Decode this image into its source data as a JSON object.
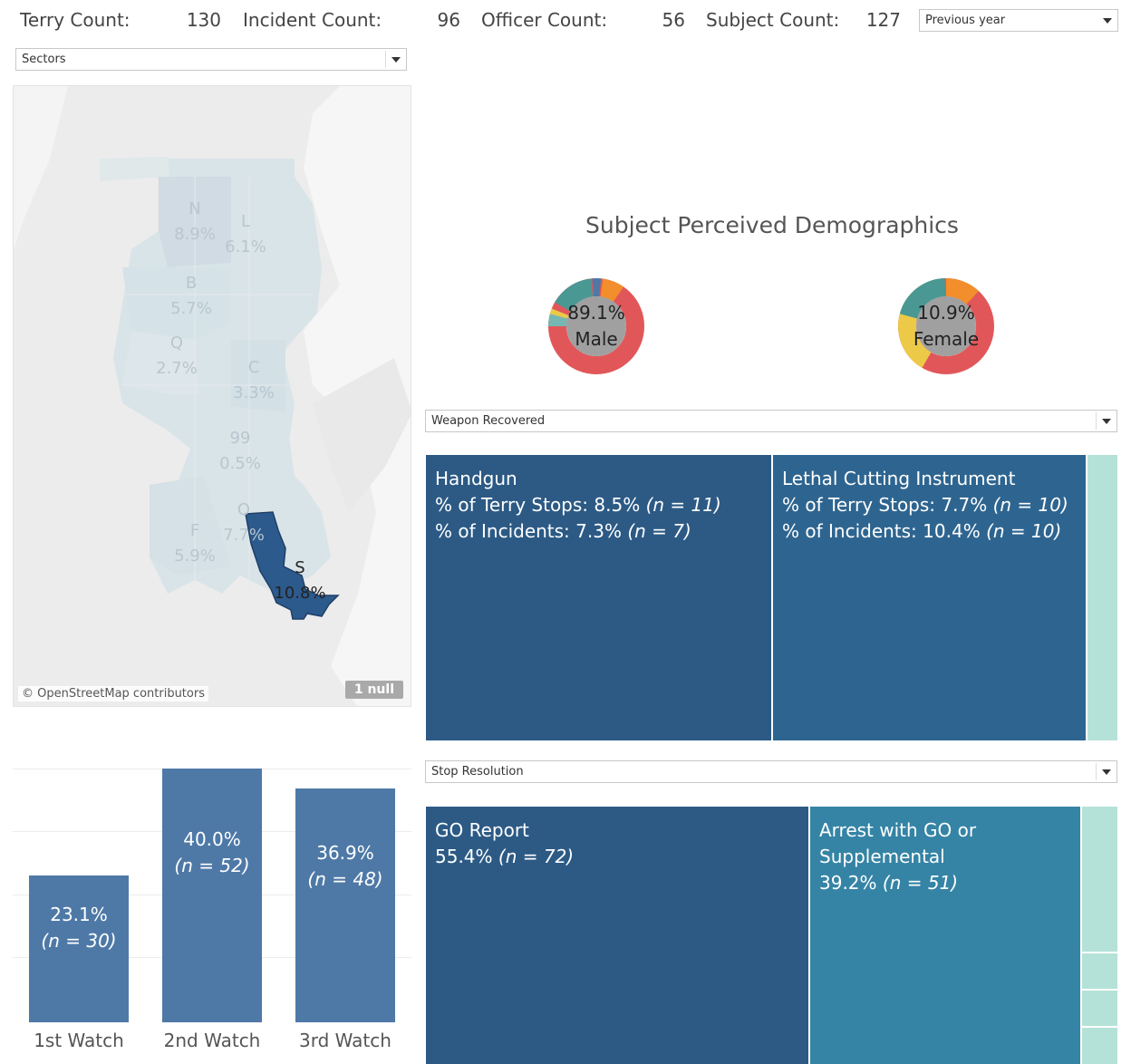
{
  "kpis": {
    "terry_label": "Terry Count:",
    "terry_value": "130",
    "incident_label": "Incident Count:",
    "incident_value": "96",
    "officer_label": "Officer Count:",
    "officer_value": "56",
    "subject_label": "Subject Count:",
    "subject_value": "127"
  },
  "filters": {
    "period": "Previous year",
    "geography": "Sectors",
    "weapon": "Weapon Recovered",
    "resolution": "Stop Resolution"
  },
  "map": {
    "sectors": [
      {
        "code": "N",
        "pct": "8.9%"
      },
      {
        "code": "L",
        "pct": "6.1%"
      },
      {
        "code": "B",
        "pct": "5.7%"
      },
      {
        "code": "Q",
        "pct": "2.7%"
      },
      {
        "code": "C",
        "pct": "3.3%"
      },
      {
        "code": "99",
        "pct": "0.5%"
      },
      {
        "code": "F",
        "pct": "5.9%"
      },
      {
        "code": "O",
        "pct": "7.7%"
      },
      {
        "code": "S",
        "pct": "10.8%"
      }
    ],
    "attribution": "© OpenStreetMap contributors",
    "null_badge": "1 null",
    "highlight_color": "#2c5a8c"
  },
  "watch_chart": {
    "bars": [
      {
        "label": "1st Watch",
        "pct": "23.1%",
        "n": "(n = 30)",
        "value": 30
      },
      {
        "label": "2nd Watch",
        "pct": "40.0%",
        "n": "(n = 52)",
        "value": 52
      },
      {
        "label": "3rd Watch",
        "pct": "36.9%",
        "n": "(n = 48)",
        "value": 48
      }
    ],
    "bar_color": "#4e79a7"
  },
  "demographics": {
    "title": "Subject Perceived Demographics",
    "male": {
      "pct": "89.1%",
      "label": "Male"
    },
    "female": {
      "pct": "10.9%",
      "label": "Female"
    },
    "colors": {
      "red": "#e15759",
      "yellow": "#edc948",
      "teal": "#499894",
      "orange": "#f28e2b",
      "blue": "#4e79a7",
      "lightteal": "#76b7b2",
      "grey": "#bab0ac",
      "center": "#a0a0a0"
    }
  },
  "weapon_treemap": {
    "tiles": [
      {
        "name": "Handgun",
        "terry": "% of Terry Stops: 8.5% ",
        "terry_n": "(n = 11)",
        "incidents": "% of Incidents: 7.3% ",
        "incidents_n": "(n = 7)",
        "color": "#2c5a85"
      },
      {
        "name": "Lethal Cutting Instrument",
        "terry": "% of Terry Stops: 7.7% ",
        "terry_n": "(n = 10)",
        "incidents": "% of Incidents: 10.4% ",
        "incidents_n": "(n = 10)",
        "color": "#2e6590"
      }
    ],
    "other_color": "#b5e2d8"
  },
  "resolution_treemap": {
    "tiles": [
      {
        "name": "GO Report",
        "value": "55.4% ",
        "n": "(n = 72)",
        "color": "#2c5a85"
      },
      {
        "name": "Arrest with GO or Supplemental",
        "value": "39.2% ",
        "n": "(n = 51)",
        "color": "#3584a5"
      }
    ],
    "other_color": "#b5e2d8"
  }
}
